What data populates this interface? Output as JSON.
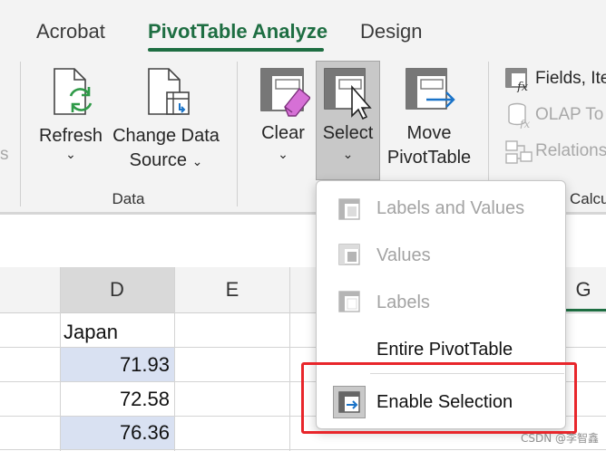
{
  "ribbon": {
    "tabs": [
      {
        "label": "Acrobat",
        "active": false
      },
      {
        "label": "PivotTable Analyze",
        "active": true
      },
      {
        "label": "Design",
        "active": false
      }
    ],
    "left_cut_label": "s",
    "buttons": {
      "refresh": {
        "label": "Refresh",
        "icon": "refresh-icon"
      },
      "change_data_source": {
        "label_line1": "Change Data",
        "label_line2": "Source",
        "icon": "change-data-source-icon"
      },
      "clear": {
        "label": "Clear",
        "icon": "clear-icon"
      },
      "select": {
        "label": "Select",
        "icon": "select-icon",
        "pressed": true
      },
      "move_pivottable": {
        "label_line1": "Move",
        "label_line2": "PivotTable",
        "icon": "move-pivottable-icon"
      }
    },
    "groups": {
      "data_label": "Data",
      "calc_label_cut": "Calcu"
    },
    "side_buttons": [
      {
        "label": "Fields, Ite",
        "icon": "fields-icon",
        "enabled": true
      },
      {
        "label": "OLAP To",
        "icon": "olap-icon",
        "enabled": false
      },
      {
        "label": "Relations",
        "icon": "relationships-icon",
        "enabled": false
      }
    ],
    "dropdown_chevron": "⌄"
  },
  "grid": {
    "columns": [
      "D",
      "E",
      "G"
    ],
    "selected_column": "D",
    "header_cell": "Japan",
    "values": [
      "71.93",
      "72.58",
      "76.36"
    ]
  },
  "select_menu": {
    "items": [
      {
        "label": "Labels and Values",
        "enabled": false,
        "icon": "pivot-labels-values-icon"
      },
      {
        "label": "Values",
        "enabled": false,
        "icon": "pivot-values-icon"
      },
      {
        "label": "Labels",
        "enabled": false,
        "icon": "pivot-labels-icon"
      },
      {
        "label": "Entire PivotTable",
        "enabled": true,
        "icon": ""
      },
      {
        "label": "Enable Selection",
        "enabled": true,
        "icon": "enable-selection-icon",
        "checked": true
      }
    ]
  },
  "colors": {
    "accent": "#1e6e42",
    "highlight_red": "#e8262b",
    "cell_blue": "#d9e1f2"
  },
  "watermark": "CSDN @李智鑫"
}
